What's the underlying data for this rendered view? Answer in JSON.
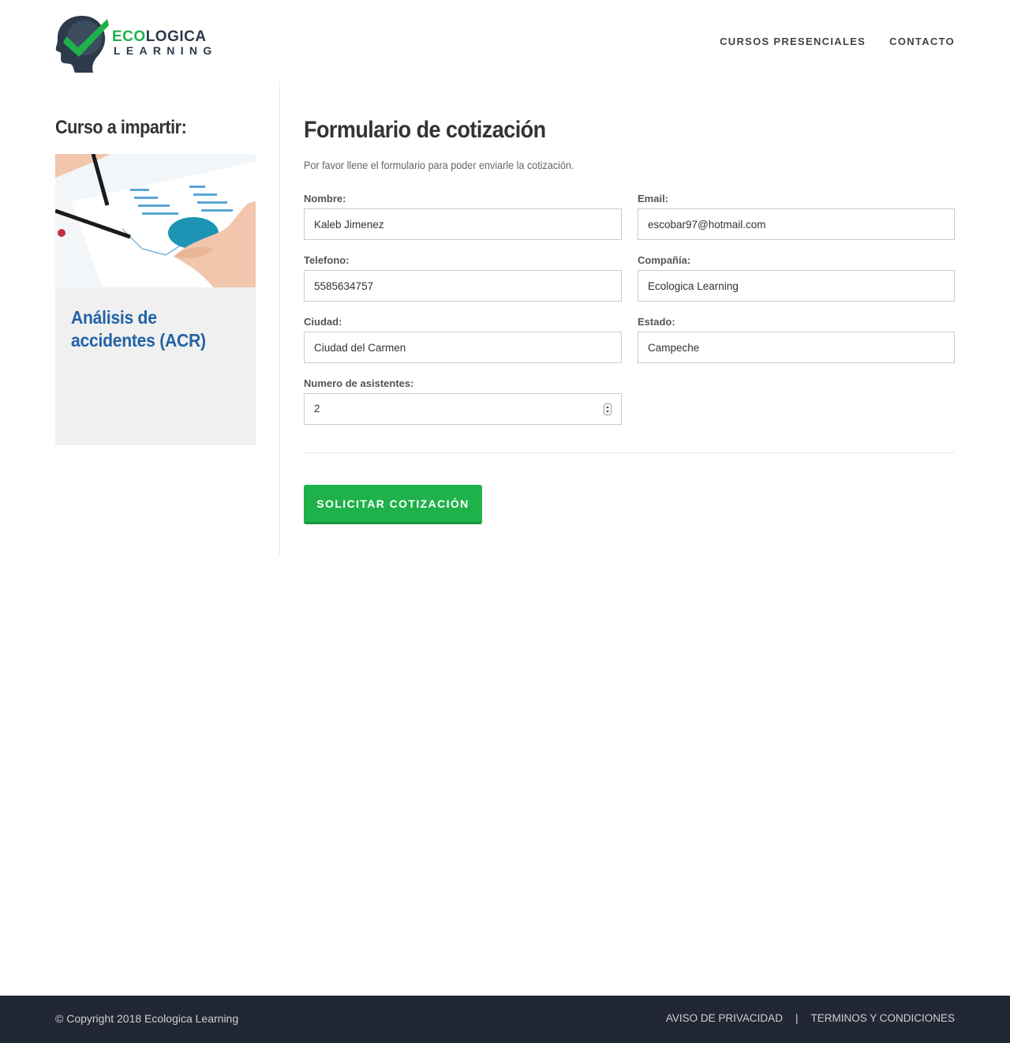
{
  "brand": {
    "name_part1": "ECO",
    "name_part2": "LOGICA",
    "name_line2": "LEARNING",
    "green": "#1fb14a",
    "dark": "#2c3a4a"
  },
  "nav": {
    "items": [
      {
        "label": "CURSOS PRESENCIALES"
      },
      {
        "label": "CONTACTO"
      }
    ]
  },
  "course": {
    "heading": "Curso a impartir:",
    "title": "Análisis de accidentes (ACR)",
    "title_color": "#2363a5"
  },
  "form": {
    "title": "Formulario de cotización",
    "description": "Por favor llene el formulario para poder enviarle la cotización.",
    "fields": {
      "nombre": {
        "label": "Nombre:",
        "value": "Kaleb Jimenez"
      },
      "email": {
        "label": "Email:",
        "value": "escobar97@hotmail.com"
      },
      "telefono": {
        "label": "Telefono:",
        "value": "5585634757"
      },
      "compania": {
        "label": "Compañía:",
        "value": "Ecologica Learning"
      },
      "ciudad": {
        "label": "Ciudad:",
        "value": "Ciudad del Carmen"
      },
      "estado": {
        "label": "Estado:",
        "value": "Campeche"
      },
      "asistentes": {
        "label": "Numero de asistentes:",
        "value": "2"
      }
    },
    "submit_label": "SOLICITAR COTIZACIÓN",
    "submit_color": "#1fb14a"
  },
  "footer": {
    "copyright": "© Copyright 2018 Ecologica Learning",
    "links": [
      {
        "label": "AVISO DE PRIVACIDAD"
      },
      {
        "label": "TERMINOS Y CONDICIONES"
      }
    ],
    "separator": "|",
    "background": "#212734"
  }
}
